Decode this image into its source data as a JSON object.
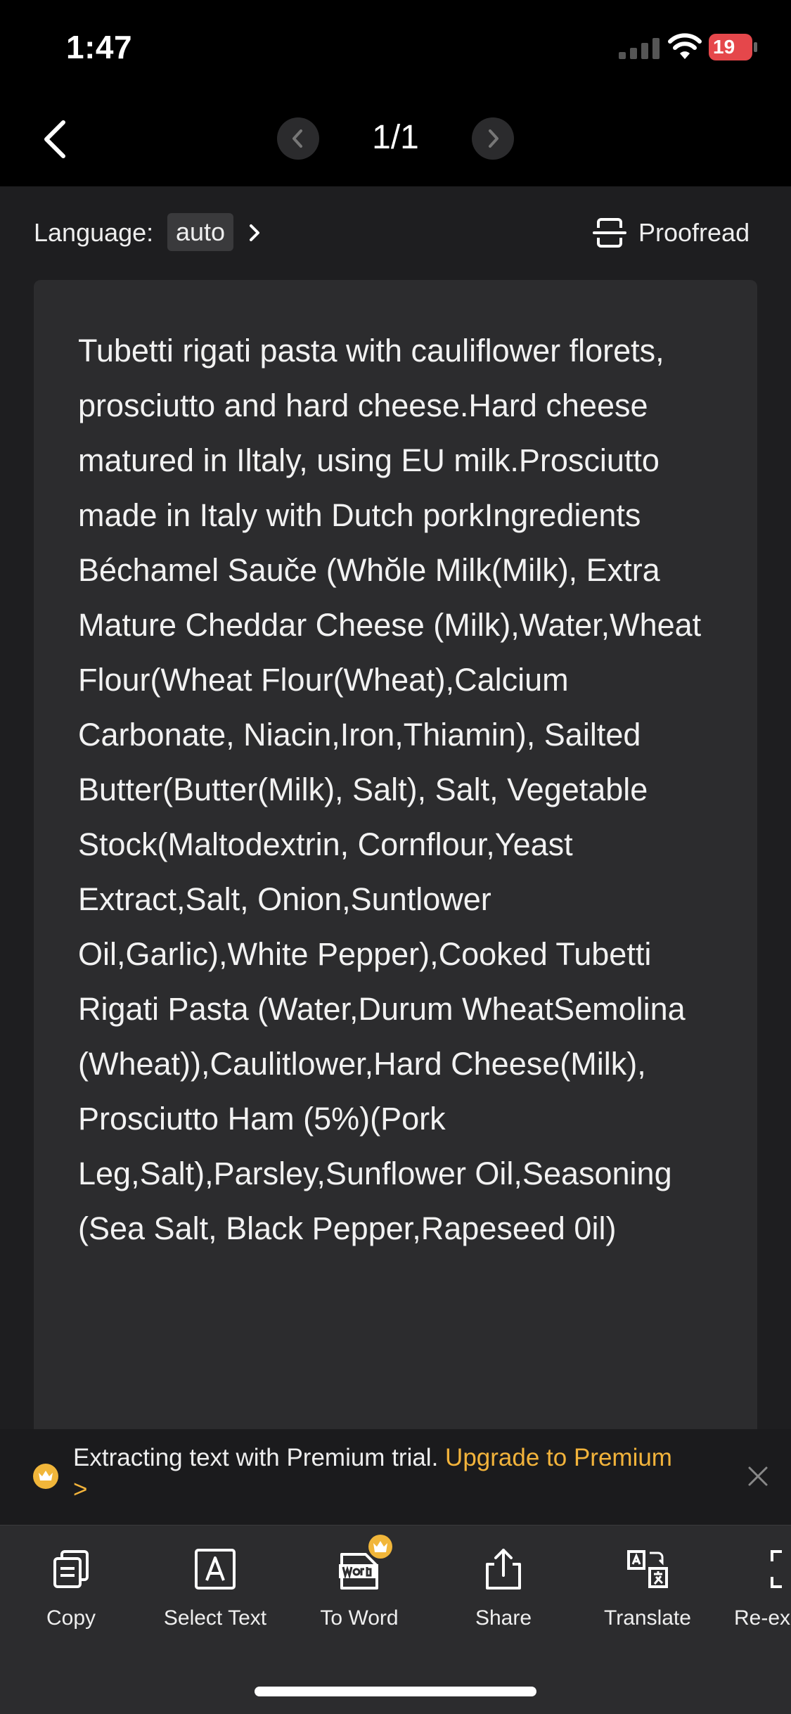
{
  "status_bar": {
    "time": "1:47",
    "battery": "19"
  },
  "nav": {
    "page_indicator": "1/1"
  },
  "language_bar": {
    "label": "Language:",
    "value": "auto",
    "proofread_label": "Proofread"
  },
  "ocr_text": "Tubetti rigati pasta with cauliflower florets, prosciutto and hard cheese.Hard cheese matured in Iltaly, using EU milk.Prosciutto made in Italy with Dutch porkIngredients Béchamel Sauče (Whŏle Milk(Milk), Extra Mature Cheddar Cheese (Milk),Water,Wheat Flour(Wheat Flour(Wheat),Calcium Carbonate, Niacin,Iron,Thiamin), Sailted Butter(Butter(Milk), Salt), Salt, Vegetable Stock(Maltodextrin, Cornflour,Yeast Extract,Salt, Onion,Suntlower Oil,Garlic),White Pepper),Cooked Tubetti Rigati Pasta (Water,Durum WheatSemolina (Wheat)),Caulitlower,Hard Cheese(Milk), Prosciutto Ham (5%)(Pork Leg,Salt),Parsley,Sunflower Oil,Seasoning (Sea Salt, Black Pepper,Rapeseed 0il)",
  "premium_banner": {
    "text": "Extracting text with Premium trial. ",
    "link": "Upgrade to Premium >"
  },
  "toolbar": {
    "copy": "Copy",
    "select_text": "Select Text",
    "to_word": "To Word",
    "share": "Share",
    "translate": "Translate",
    "re_extract": "Re-ex"
  },
  "colors": {
    "accent": "#f2b33b",
    "battery_low": "#e5474b",
    "card": "#2c2c2e"
  }
}
